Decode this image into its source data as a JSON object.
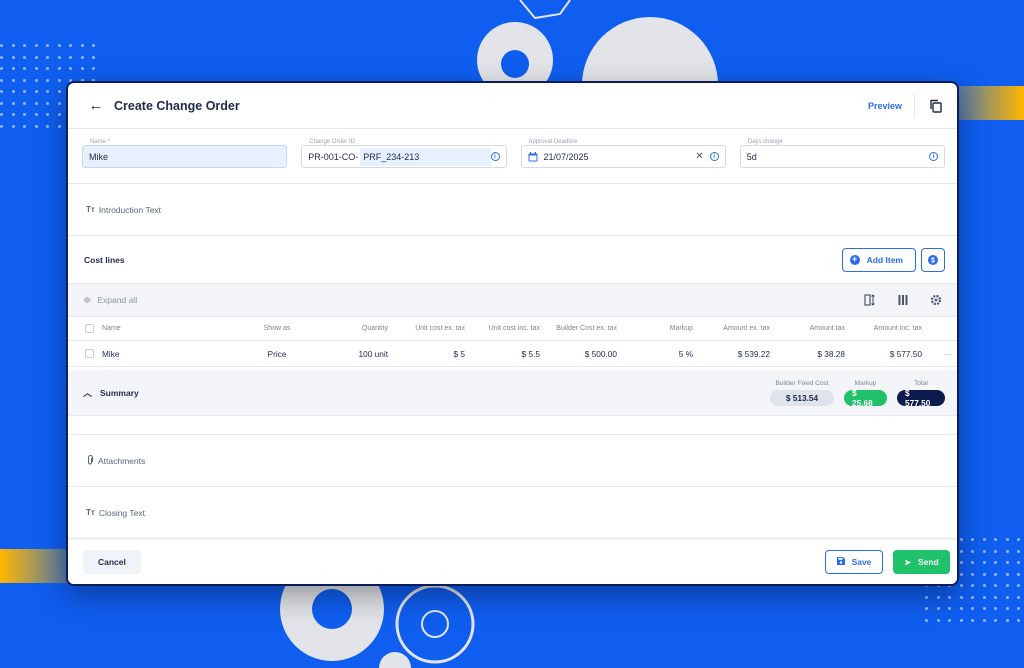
{
  "header": {
    "title": "Create Change Order",
    "preview_label": "Preview"
  },
  "fields": {
    "name": {
      "label": "Name *",
      "value": "Mike"
    },
    "change_order_id": {
      "label": "Change Order ID",
      "prefix": "PR-001-CO-",
      "value": "PRF_234-213"
    },
    "approval_deadline": {
      "label": "Approval Deadline",
      "value": "21/07/2025"
    },
    "days_change": {
      "label": "Days change",
      "value": "5d"
    }
  },
  "introduction": {
    "label": "Introduction Text"
  },
  "cost_lines": {
    "title": "Cost lines",
    "add_item_label": "Add Item",
    "expand_all_label": "Expand all",
    "columns": [
      "Name",
      "Show as",
      "Quantity",
      "Unit cost ex. tax",
      "Unit cost inc. tax",
      "Builder Cost ex. tax",
      "Markup",
      "Amount ex. tax",
      "Amount tax",
      "Amount inc. tax"
    ],
    "rows": [
      {
        "name": "Mike",
        "show_as": "Price",
        "quantity": "100 unit",
        "unit_ex": "$ 5",
        "unit_inc": "$ 5.5",
        "builder_cost": "$ 500.00",
        "markup": "5 %",
        "amount_ex": "$ 539.22",
        "amount_tax": "$ 38.28",
        "amount_inc": "$ 577.50",
        "more": "···"
      }
    ]
  },
  "summary": {
    "title": "Summary",
    "builder_fixed_cost_label": "Builder Fixed Cost",
    "builder_fixed_cost": "$ 513.54",
    "markup_label": "Markup",
    "markup": "$ 25.68",
    "total_label": "Total",
    "total": "$ 577.50"
  },
  "attachments": {
    "label": "Attachments"
  },
  "closing": {
    "label": "Closing Text"
  },
  "footer": {
    "cancel_label": "Cancel",
    "save_label": "Save",
    "send_label": "Send"
  },
  "colors": {
    "background": "#0f5ef0",
    "accent": "#2b6de8",
    "success": "#1fc16b",
    "navy": "#0d1a4d"
  }
}
